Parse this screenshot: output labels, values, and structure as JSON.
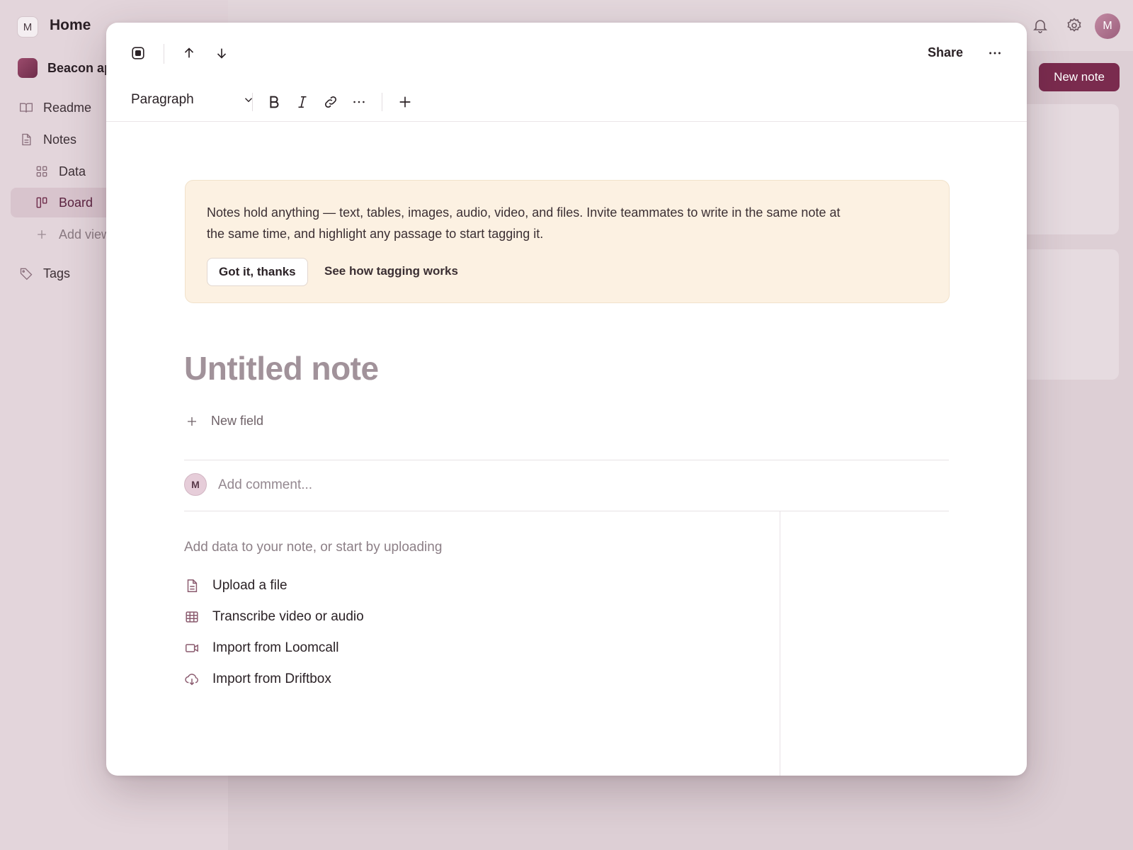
{
  "app": {
    "workspace_initial": "M",
    "home_title": "Home",
    "project_name": "Beacon ap",
    "user_initial": "M",
    "new_note_label": "New note"
  },
  "sidebar": {
    "items": [
      {
        "label": "Readme",
        "icon": "book-icon"
      },
      {
        "label": "Notes",
        "icon": "document-icon"
      },
      {
        "label": "Data",
        "icon": "grid-icon"
      },
      {
        "label": "Board",
        "icon": "board-icon",
        "active": true
      },
      {
        "label": "Add view",
        "icon": "plus-icon"
      },
      {
        "label": "Tags",
        "icon": "tag-icon"
      }
    ]
  },
  "modal": {
    "share_label": "Share",
    "format_select": "Paragraph",
    "banner": {
      "text": "Notes hold anything — text, tables, images, audio, video, and files. Invite teammates to write in the same note at the same time, and highlight any passage to start tagging it.",
      "got_it": "Got it, thanks",
      "see_how": "See how tagging works"
    },
    "title": "Untitled note",
    "new_field": "New field",
    "comment": {
      "avatar_initial": "M",
      "placeholder": "Add comment..."
    },
    "add_data_hint": "Add data to your note, or start by uploading",
    "actions": [
      {
        "label": "Upload a file",
        "icon": "file-icon"
      },
      {
        "label": "Transcribe video or audio",
        "icon": "table-icon"
      },
      {
        "label": "Import from Loomcall",
        "icon": "video-icon"
      },
      {
        "label": "Import from Driftbox",
        "icon": "cloud-download-icon"
      }
    ]
  },
  "colors": {
    "accent": "#7a2b4e",
    "banner_bg": "#fcf1e2",
    "background": "#e6dadf"
  }
}
